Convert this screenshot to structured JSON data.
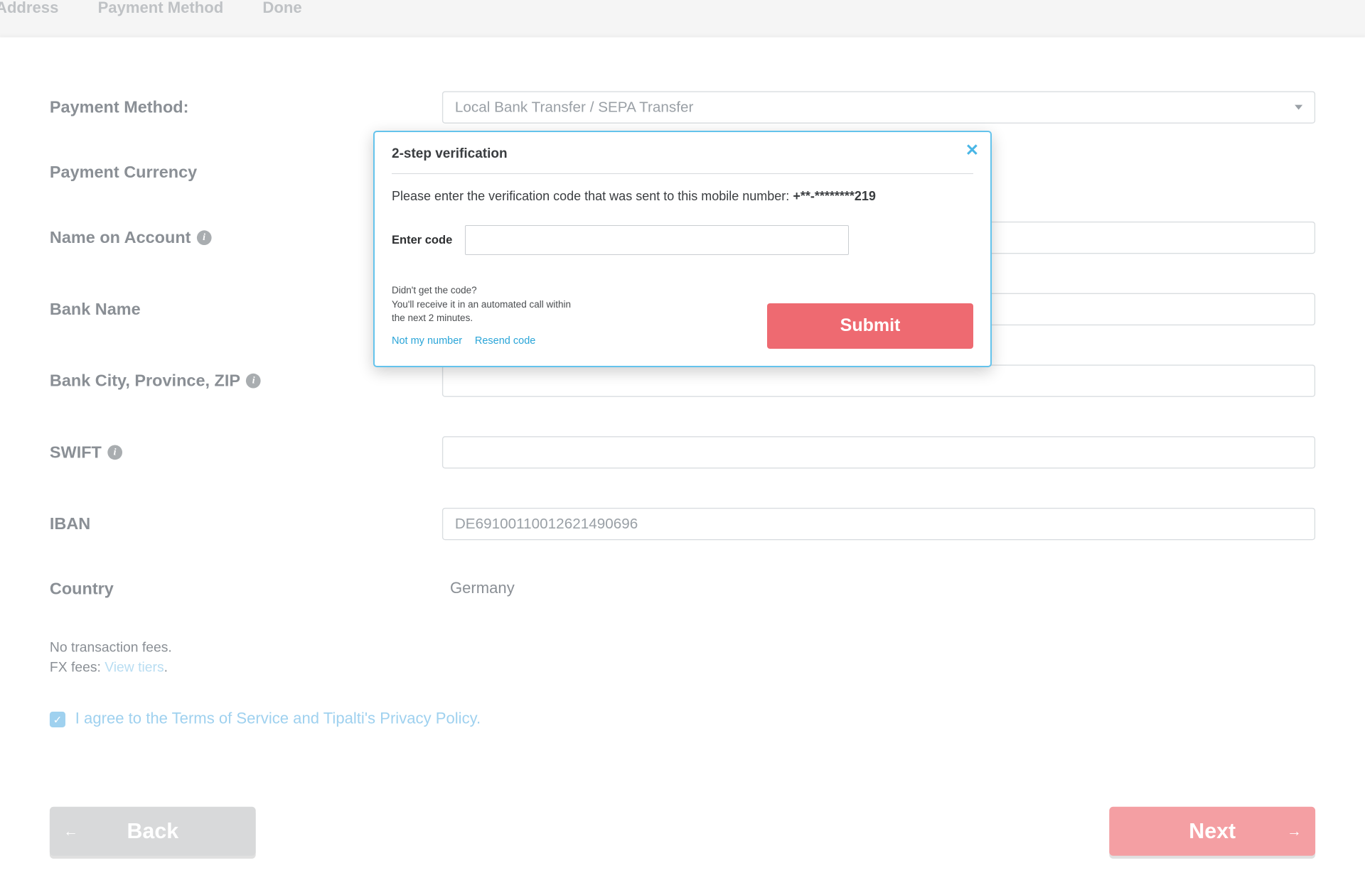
{
  "stepper": {
    "address": "Address",
    "payment_method": "Payment Method",
    "done": "Done"
  },
  "form": {
    "payment_method_label": "Payment Method:",
    "payment_method_value": "Local Bank Transfer / SEPA Transfer",
    "currency_label": "Payment Currency",
    "name_on_account_label": "Name on Account",
    "bank_name_label": "Bank Name",
    "bank_city_label": "Bank City, Province, ZIP",
    "swift_label": "SWIFT",
    "iban_label": "IBAN",
    "iban_value": "DE69100110012621490696",
    "country_label": "Country",
    "country_value": "Germany"
  },
  "fees": {
    "line1": "No transaction fees.",
    "fx_prefix": "FX fees: ",
    "view_tiers": "View tiers"
  },
  "agree": {
    "text": "I agree to the Terms of Service and Tipalti's Privacy Policy.",
    "checked": true
  },
  "nav": {
    "back": "Back",
    "next": "Next"
  },
  "modal": {
    "title": "2-step verification",
    "body_prefix": "Please enter the verification code that was sent to this mobile number: ",
    "phone_masked": "+**-********219",
    "enter_code_label": "Enter code",
    "didnt_get": "Didn't get the code?",
    "auto_call": "You'll receive it in an automated call within the next 2 minutes.",
    "not_my_number": "Not my number",
    "resend": "Resend code",
    "submit": "Submit"
  }
}
